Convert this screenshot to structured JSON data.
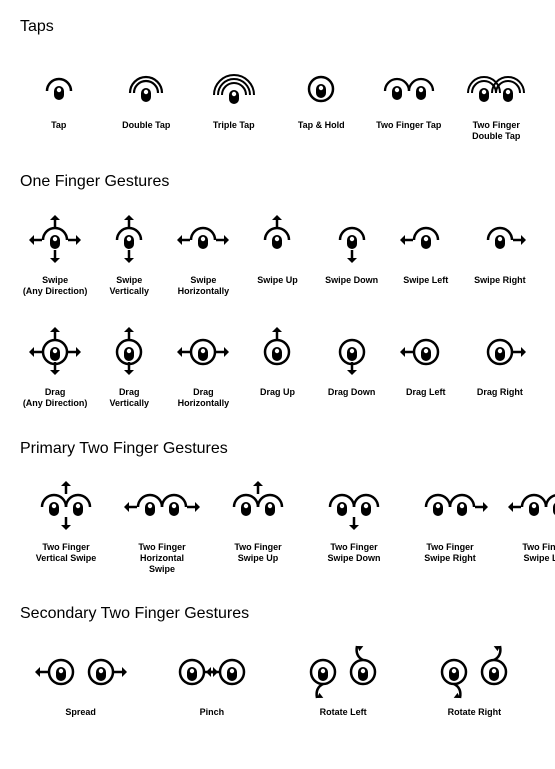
{
  "sections": {
    "taps": {
      "title": "Taps",
      "items": [
        {
          "id": "tap",
          "label": "Tap"
        },
        {
          "id": "double-tap",
          "label": "Double Tap"
        },
        {
          "id": "triple-tap",
          "label": "Triple Tap"
        },
        {
          "id": "tap-hold",
          "label": "Tap & Hold"
        },
        {
          "id": "two-finger-tap",
          "label": "Two Finger Tap"
        },
        {
          "id": "two-finger-double-tap",
          "label": "Two Finger\nDouble Tap"
        }
      ]
    },
    "one_finger": {
      "title": "One Finger Gestures",
      "row1": [
        {
          "id": "swipe-any",
          "label": "Swipe\n(Any Direction)"
        },
        {
          "id": "swipe-vert",
          "label": "Swipe\nVertically"
        },
        {
          "id": "swipe-horiz",
          "label": "Swipe\nHorizontally"
        },
        {
          "id": "swipe-up",
          "label": "Swipe Up"
        },
        {
          "id": "swipe-down",
          "label": "Swipe Down"
        },
        {
          "id": "swipe-left",
          "label": "Swipe Left"
        },
        {
          "id": "swipe-right",
          "label": "Swipe Right"
        }
      ],
      "row2": [
        {
          "id": "drag-any",
          "label": "Drag\n(Any Direction)"
        },
        {
          "id": "drag-vert",
          "label": "Drag\nVertically"
        },
        {
          "id": "drag-horiz",
          "label": "Drag\nHorizontally"
        },
        {
          "id": "drag-up",
          "label": "Drag Up"
        },
        {
          "id": "drag-down",
          "label": "Drag Down"
        },
        {
          "id": "drag-left",
          "label": "Drag Left"
        },
        {
          "id": "drag-right",
          "label": "Drag Right"
        }
      ]
    },
    "primary_two": {
      "title": "Primary Two Finger Gestures",
      "items": [
        {
          "id": "two-vert-swipe",
          "label": "Two Finger\nVertical Swipe"
        },
        {
          "id": "two-horiz-swipe",
          "label": "Two Finger\nHorizontal\nSwipe"
        },
        {
          "id": "two-swipe-up",
          "label": "Two Finger\nSwipe Up"
        },
        {
          "id": "two-swipe-down",
          "label": "Two Finger\nSwipe Down"
        },
        {
          "id": "two-swipe-right",
          "label": "Two Finger\nSwipe Right"
        },
        {
          "id": "two-swipe-left",
          "label": "Two Finger\nSwipe Left"
        }
      ]
    },
    "secondary_two": {
      "title": "Secondary Two Finger Gestures",
      "items": [
        {
          "id": "spread",
          "label": "Spread"
        },
        {
          "id": "pinch",
          "label": "Pinch"
        },
        {
          "id": "rotate-left",
          "label": "Rotate Left"
        },
        {
          "id": "rotate-right",
          "label": "Rotate Right"
        }
      ]
    }
  }
}
